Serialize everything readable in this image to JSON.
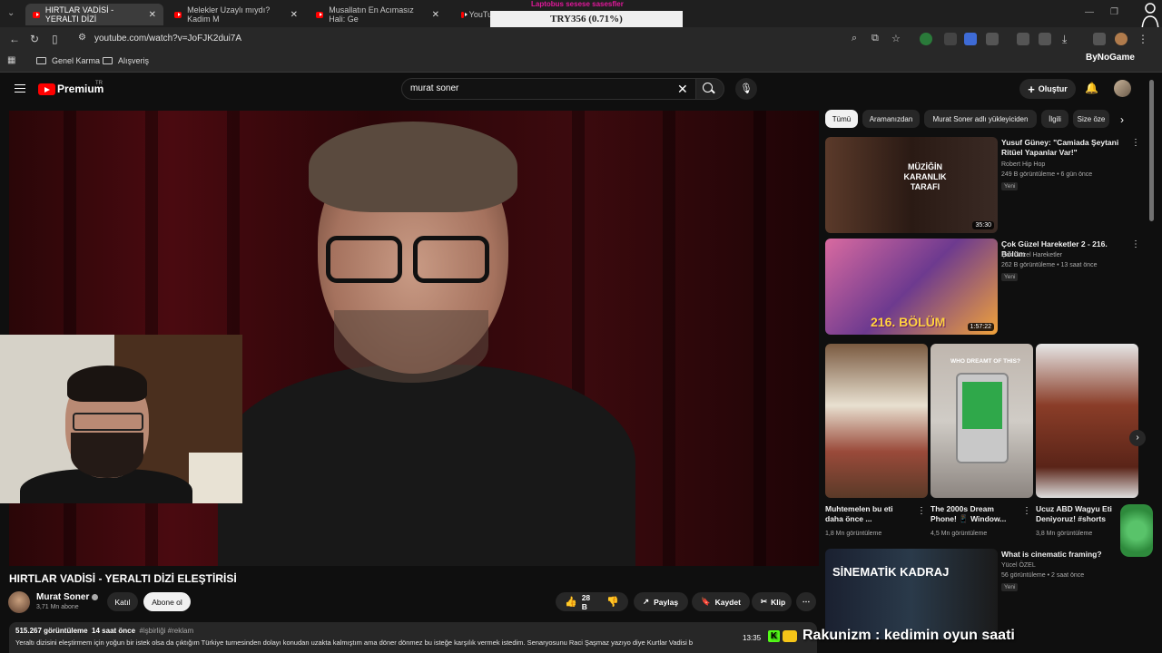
{
  "browser": {
    "tabs": [
      {
        "label": "HIRTLAR VADİSİ - YERALTI DİZİ"
      },
      {
        "label": "Melekler Uzaylı mıydı? Kadim M"
      },
      {
        "label": "Musallatın En Acımasız Hali: Ge"
      },
      {
        "label": "YouTu"
      }
    ],
    "url": "youtube.com/watch?v=JoFJK2dui7A",
    "bookmarks": [
      {
        "label": "Genel Karma"
      },
      {
        "label": "Alışveriş"
      }
    ],
    "overlay_brand": "ByNoGame"
  },
  "stream_overlay": {
    "donation_header": "Laptobus sesese sasesfler",
    "donation_text": "TRY356 (0.71%)",
    "chat_user": "Rakunizm",
    "chat_sep": ":",
    "chat_message": "kedimin oyun saati",
    "chat_time": "13:35"
  },
  "youtube": {
    "logo_text": "Premium",
    "logo_region": "TR",
    "search_query": "murat soner",
    "create_label": "Oluştur",
    "colors": {
      "accent": "#ff0000",
      "background": "#0f0f0f",
      "chip_bg": "#272727"
    }
  },
  "video": {
    "title": "HIRTLAR VADİSİ - YERALTI DİZİ ELEŞTİRİSİ",
    "channel": "Murat Soner",
    "subscribers": "3,71 Mn abone",
    "join_label": "Katıl",
    "subscribe_label": "Abone ol",
    "likes": "28 B",
    "share_label": "Paylaş",
    "save_label": "Kaydet",
    "clip_label": "Klip",
    "views": "515.267 görüntüleme",
    "age": "14 saat önce",
    "tags": "#işbirliği #reklam",
    "description": "Yeraltı dizisini eleştirmem için yoğun bir istek olsa da çıktığım Türkiye turnesinden dolayı konudan uzakta kalmıştım ama döner dönmez bu isteğe karşılık vermek istedim. Senaryosunu Raci Şaşmaz yazıyo diye Kurtlar Vadisi b"
  },
  "sidebar": {
    "chips": [
      "Tümü",
      "Aramanızdan",
      "Murat Soner adlı yükleyiciden",
      "İlgili",
      "Size öze"
    ],
    "videos": [
      {
        "title": "Yusuf Güney: \"Camiada Şeytani Ritüel Yapanlar Var!\"",
        "channel": "Robert Hip Hop",
        "meta": "249 B görüntüleme • 6 gün önce",
        "badge": "Yeni",
        "duration": "35:30",
        "thumb_text": "MÜZİĞİN KARANLIK TARAFI"
      },
      {
        "title": "Çok Güzel Hareketler 2 - 216. Bölüm",
        "channel": "Çok Güzel Hareketler",
        "meta": "262 B görüntüleme • 13 saat önce",
        "badge": "Yeni",
        "duration": "1:57:22",
        "thumb_text": "216. BÖLÜM"
      },
      {
        "title": "What is cinematic framing?",
        "channel": "Yücel ÖZEL",
        "meta": "56 görüntüleme • 2 saat önce",
        "badge": "Yeni",
        "thumb_text": "SİNEMATİK KADRAJ"
      }
    ],
    "shorts": [
      {
        "title": "Muhtemelen bu eti daha önce ...",
        "views": "1,8 Mn görüntüleme"
      },
      {
        "title": "The 2000s Dream Phone! 📱 Window...",
        "views": "4,5 Mn görüntüleme",
        "thumb_text": "WHO DREAMT OF THIS?"
      },
      {
        "title": "Ucuz ABD Wagyu Eti Deniyoruz! #shorts",
        "views": "3,8 Mn görüntüleme"
      }
    ]
  }
}
